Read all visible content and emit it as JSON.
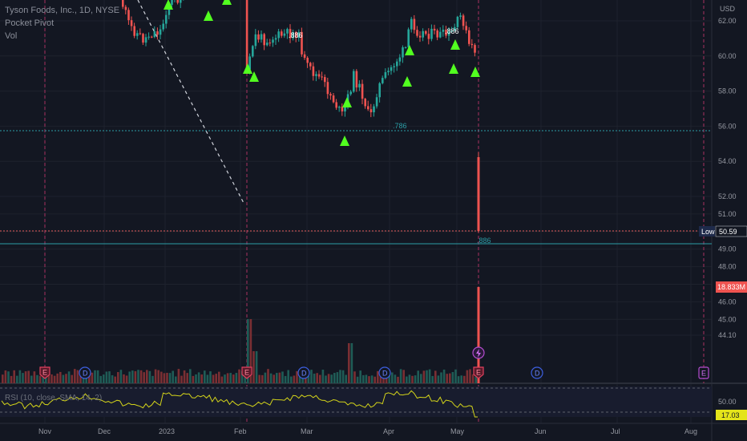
{
  "legend": {
    "symbol": "Tyson Foods, Inc., 1D, NYSE",
    "indicator1": "Pocket Pivot",
    "indicator2": "Vol",
    "rsi_label": "RSI (10, close, SMA, 14, 2)"
  },
  "axis": {
    "currency": "USD",
    "price_ticks": [
      "62.00",
      "60.00",
      "58.00",
      "56.00",
      "54.00",
      "52.00",
      "51.00",
      "50.00",
      "49.00",
      "48.00",
      "47.00",
      "46.00",
      "45.00",
      "44.10"
    ],
    "rsi_tick": "50.00",
    "x_ticks": [
      "Nov",
      "Dec",
      "2023",
      "Feb",
      "Mar",
      "Apr",
      "May",
      "Jun",
      "Jul",
      "Aug"
    ]
  },
  "tags": {
    "low_label": "Low",
    "low_value": "50.59",
    "volume_value": "18.833M",
    "rsi_value": "17.03"
  },
  "fib_labels": {
    "upper": ".886",
    "mid": ".786",
    "lower": ".886"
  },
  "event_markers": {
    "earnings": "E",
    "dividend": "D"
  },
  "colors": {
    "background": "#131722",
    "up": "#26a69a",
    "down": "#ef5350",
    "pivot": "#52ff20",
    "rsi_line": "#d4d41a",
    "fib_line": "#2b9ea6",
    "low_line": "#e05a5a",
    "earnings": "#e0415e",
    "dividend": "#3d5fe0"
  },
  "chart_data": {
    "type": "candlestick",
    "price_range": [
      44.1,
      62.8
    ],
    "rsi_range": [
      0,
      100
    ],
    "x_ticks": [
      "Nov",
      "Dec",
      "2023",
      "Feb",
      "Mar",
      "Apr",
      "May",
      "Jun",
      "Jul",
      "Aug"
    ],
    "key_levels": {
      "low": 50.59,
      "fib_786": 55.8
    },
    "last_volume": "18.833M",
    "last_rsi": 17.03,
    "series_close_estimates": [
      {
        "period": "Dec",
        "close": 61.5
      },
      {
        "period": "Jan",
        "close": 62.5
      },
      {
        "period": "early Feb",
        "close": 61.0
      },
      {
        "period": "Mar",
        "close": 58.5
      },
      {
        "period": "mid Mar",
        "close": 56.5
      },
      {
        "period": "Apr",
        "close": 59.5
      },
      {
        "period": "late Apr",
        "close": 61.5
      },
      {
        "period": "early May",
        "close": 60.5
      },
      {
        "period": "May 8",
        "close": 50.59
      }
    ]
  }
}
